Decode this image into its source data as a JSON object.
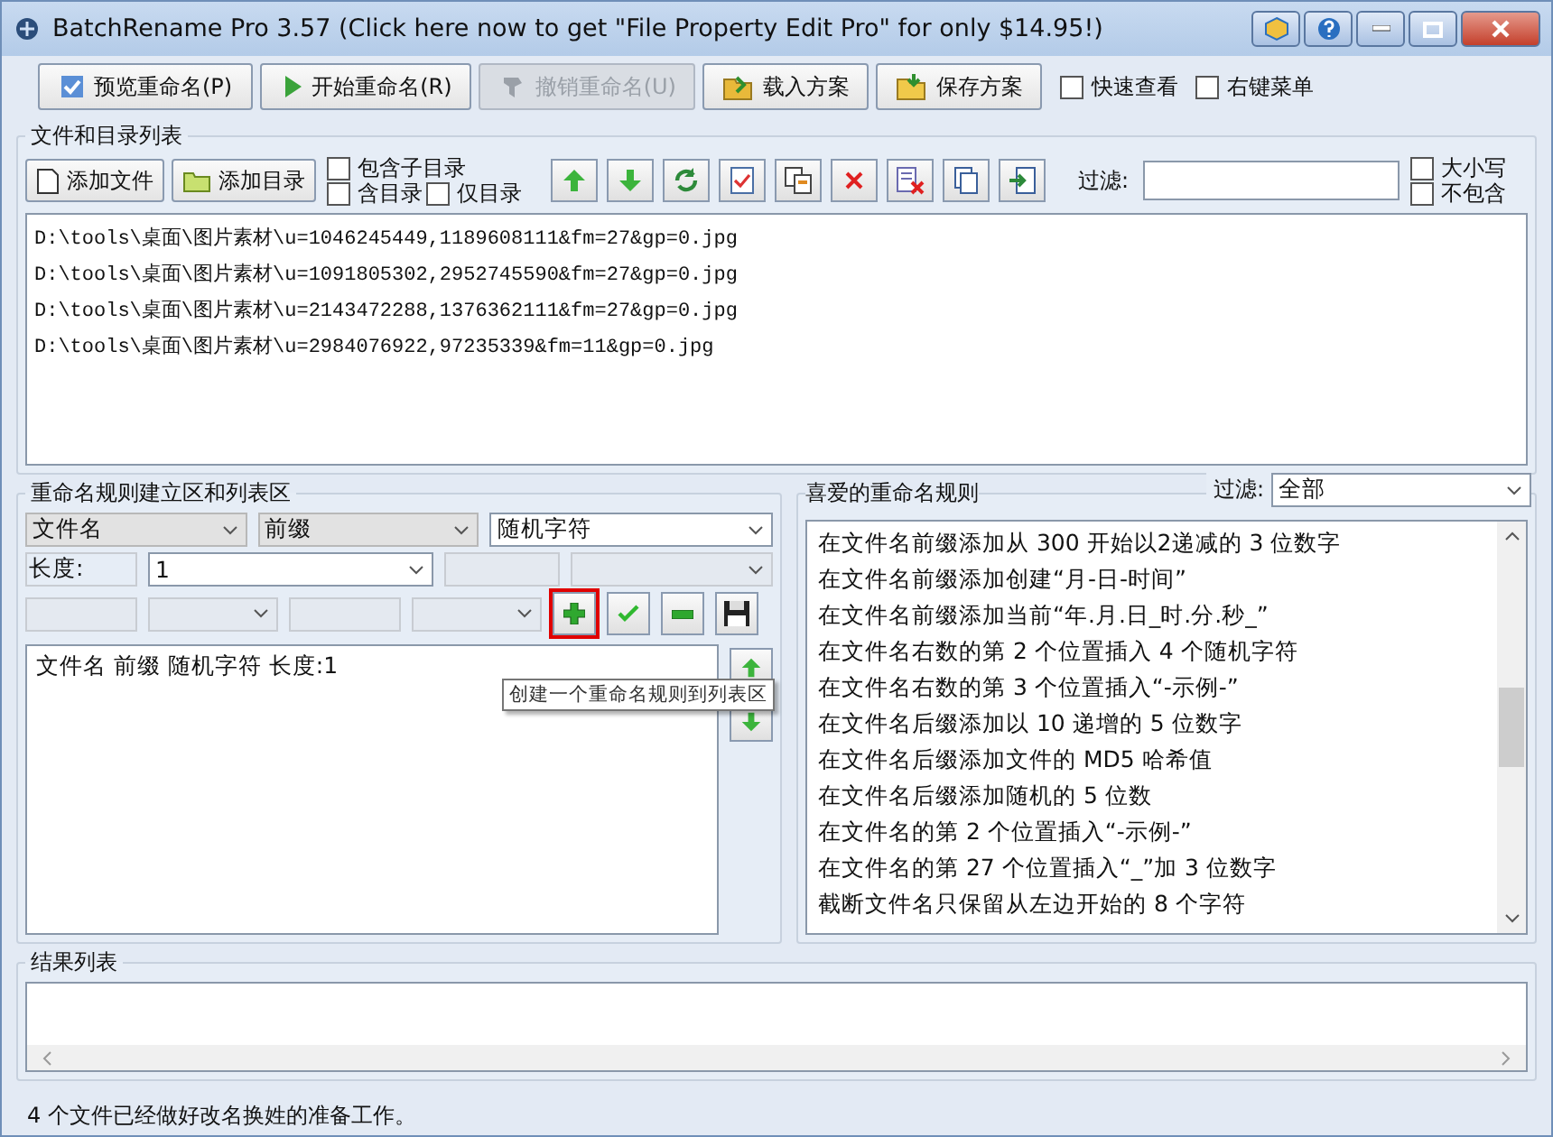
{
  "window": {
    "title": "BatchRename Pro 3.57  (Click here now to get \"File Property Edit Pro\" for only $14.95!)"
  },
  "toolbar": {
    "buttons": [
      {
        "label": "预览重命名(P)",
        "kind": "preview",
        "disabled": false
      },
      {
        "label": "开始重命名(R)",
        "kind": "start",
        "disabled": false
      },
      {
        "label": "撤销重命名(U)",
        "kind": "undo",
        "disabled": true
      },
      {
        "label": "载入方案",
        "kind": "load",
        "disabled": false
      },
      {
        "label": "保存方案",
        "kind": "save",
        "disabled": false
      }
    ],
    "checkboxes": [
      {
        "label": "快速查看",
        "checked": false
      },
      {
        "label": "右键菜单",
        "checked": false
      }
    ]
  },
  "file_list": {
    "title": "文件和目录列表",
    "buttons": [
      {
        "label": "添加文件",
        "kind": "file"
      },
      {
        "label": "添加目录",
        "kind": "folder"
      }
    ],
    "options": [
      {
        "label": "包含子目录",
        "checked": false
      },
      {
        "label": "含目录",
        "checked": false
      },
      {
        "label": "仅目录",
        "checked": false
      }
    ],
    "tools": [
      {
        "kind": "up"
      },
      {
        "kind": "down"
      },
      {
        "kind": "refresh"
      },
      {
        "kind": "edit"
      },
      {
        "kind": "copy"
      },
      {
        "kind": "delete"
      },
      {
        "kind": "clear"
      },
      {
        "kind": "paste"
      },
      {
        "kind": "export"
      }
    ],
    "filter_label": "过滤:",
    "filter_options": [
      {
        "label": "大小写",
        "checked": false
      },
      {
        "label": "不包含",
        "checked": false
      }
    ],
    "files": [
      "D:\\tools\\桌面\\图片素材\\u=1046245449,1189608111&fm=27&gp=0.jpg",
      "D:\\tools\\桌面\\图片素材\\u=1091805302,2952745590&fm=27&gp=0.jpg",
      "D:\\tools\\桌面\\图片素材\\u=2143472288,1376362111&fm=27&gp=0.jpg",
      "D:\\tools\\桌面\\图片素材\\u=2984076922,97235339&fm=11&gp=0.jpg"
    ]
  },
  "rule_builder": {
    "title": "重命名规则建立区和列表区",
    "combos": [
      "文件名",
      "前缀",
      "随机字符"
    ],
    "length_label": "长度:",
    "length_value": "1",
    "actions": [
      {
        "kind": "add",
        "focused": true
      },
      {
        "kind": "apply",
        "focused": false
      },
      {
        "kind": "remove",
        "focused": false
      },
      {
        "kind": "save",
        "focused": false
      }
    ],
    "rules": [
      "文件名 前缀 随机字符 长度:1"
    ],
    "tooltip": "创建一个重命名规则到列表区"
  },
  "favorites": {
    "title": "喜爱的重命名规则",
    "filter_label": "过滤:",
    "filter_value": "全部",
    "items": [
      "在文件名前缀添加从 300 开始以2递减的 3 位数字",
      "在文件名前缀添加创建“月-日-时间”",
      "在文件名前缀添加当前“年.月.日_时.分.秒_”",
      "在文件名右数的第 2 个位置插入 4 个随机字符",
      "在文件名右数的第 3 个位置插入“-示例-”",
      "在文件名后缀添加以 10 递增的 5 位数字",
      "在文件名后缀添加文件的 MD5 哈希值",
      "在文件名后缀添加随机的 5 位数",
      "在文件名的第 2 个位置插入“-示例-”",
      "在文件名的第 27 个位置插入“_”加 3 位数字",
      "截断文件名只保留从左边开始的 8 个字符"
    ]
  },
  "results": {
    "title": "结果列表"
  },
  "status_bar": {
    "text": "4 个文件已经做好改名换姓的准备工作。"
  }
}
